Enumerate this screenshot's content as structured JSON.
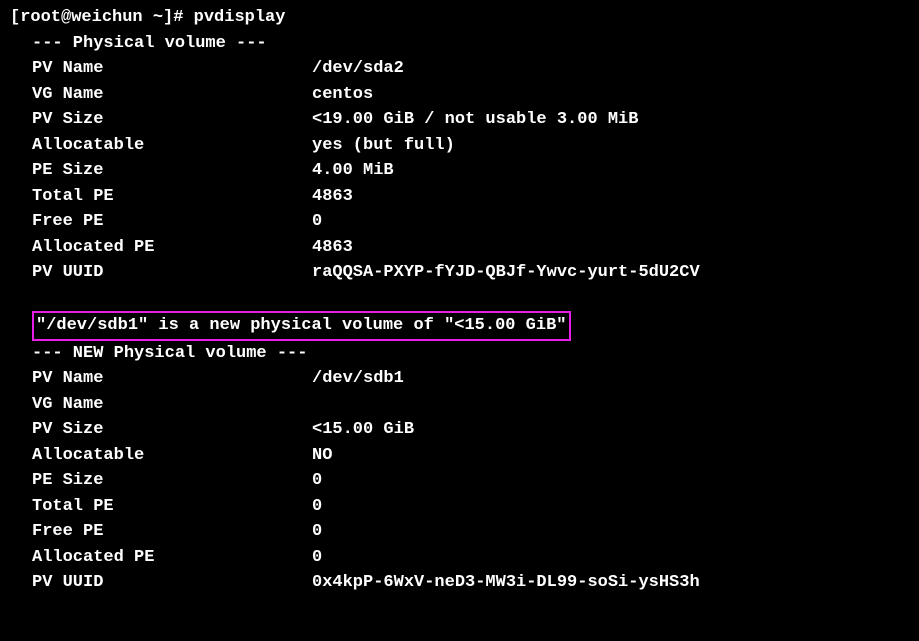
{
  "prompt": "[root@weichun ~]# ",
  "command": "pvdisplay",
  "pv1": {
    "header": "--- Physical volume ---",
    "rows": [
      {
        "label": "PV Name",
        "value": "/dev/sda2"
      },
      {
        "label": "VG Name",
        "value": "centos"
      },
      {
        "label": "PV Size",
        "value": "<19.00 GiB / not usable 3.00 MiB"
      },
      {
        "label": "Allocatable",
        "value": "yes (but full)"
      },
      {
        "label": "PE Size",
        "value": "4.00 MiB"
      },
      {
        "label": "Total PE",
        "value": "4863"
      },
      {
        "label": "Free PE",
        "value": "0"
      },
      {
        "label": "Allocated PE",
        "value": "4863"
      },
      {
        "label": "PV UUID",
        "value": "raQQSA-PXYP-fYJD-QBJf-Ywvc-yurt-5dU2CV"
      }
    ]
  },
  "highlighted_line": "\"/dev/sdb1\" is a new physical volume of \"<15.00 GiB\"",
  "pv2": {
    "header": "--- NEW Physical volume ---",
    "rows": [
      {
        "label": "PV Name",
        "value": "/dev/sdb1"
      },
      {
        "label": "VG Name",
        "value": ""
      },
      {
        "label": "PV Size",
        "value": "<15.00 GiB"
      },
      {
        "label": "Allocatable",
        "value": "NO"
      },
      {
        "label": "PE Size",
        "value": "0"
      },
      {
        "label": "Total PE",
        "value": "0"
      },
      {
        "label": "Free PE",
        "value": "0"
      },
      {
        "label": "Allocated PE",
        "value": "0"
      },
      {
        "label": "PV UUID",
        "value": "0x4kpP-6WxV-neD3-MW3i-DL99-soSi-ysHS3h"
      }
    ]
  }
}
